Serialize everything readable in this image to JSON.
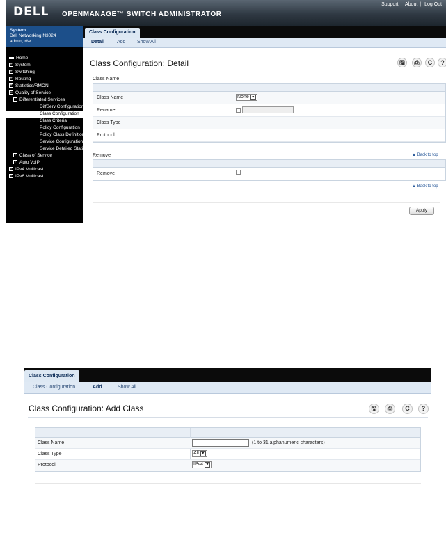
{
  "header": {
    "logo": "DELL",
    "product_title": "OPENMANAGE™ SWITCH ADMINISTRATOR",
    "links": [
      "Support",
      "About",
      "Log Out"
    ]
  },
  "system": {
    "title": "System",
    "device": "Dell Networking N3024",
    "user": "admin, r/w"
  },
  "nav_tree": [
    {
      "label": "Home",
      "level": 0,
      "icon": "home-icon"
    },
    {
      "label": "System",
      "level": 0,
      "icon": "expand-icon"
    },
    {
      "label": "Switching",
      "level": 0,
      "icon": "expand-icon"
    },
    {
      "label": "Routing",
      "level": 0,
      "icon": "expand-icon"
    },
    {
      "label": "Statistics/RMON",
      "level": 0,
      "icon": "expand-icon"
    },
    {
      "label": "Quality of Service",
      "level": 0,
      "icon": "collapse-icon"
    },
    {
      "label": "Differentiated Services",
      "level": 1,
      "icon": "collapse-icon"
    },
    {
      "label": "DiffServ Configuration",
      "level": 2
    },
    {
      "label": "Class Configuration",
      "level": 2,
      "selected": true
    },
    {
      "label": "Class Criteria",
      "level": 2
    },
    {
      "label": "Policy Configuration",
      "level": 2
    },
    {
      "label": "Policy Class Definition",
      "level": 2
    },
    {
      "label": "Service Configuration",
      "level": 2
    },
    {
      "label": "Service Detailed Statistics",
      "level": 2
    },
    {
      "label": "Class of Service",
      "level": 1,
      "icon": "expand-icon"
    },
    {
      "label": "Auto VoIP",
      "level": 1,
      "icon": "expand-icon"
    },
    {
      "label": "IPv4 Multicast",
      "level": 0,
      "icon": "expand-icon"
    },
    {
      "label": "IPv6 Multicast",
      "level": 0,
      "icon": "expand-icon"
    }
  ],
  "detail_page": {
    "tab": "Class Configuration",
    "subnav": [
      "Detail",
      "Add",
      "Show All"
    ],
    "active_subnav": "Detail",
    "title": "Class Configuration: Detail",
    "tool_icons": [
      "save-icon",
      "print-icon",
      "refresh-icon",
      "help-icon"
    ],
    "section1_title": "Class Name",
    "fields": {
      "class_name": {
        "label": "Class Name",
        "value": "None"
      },
      "rename": {
        "label": "Rename",
        "value": ""
      },
      "class_type": {
        "label": "Class Type",
        "value": ""
      },
      "protocol": {
        "label": "Protocol",
        "value": ""
      }
    },
    "section2_title": "Remove",
    "remove_label": "Remove",
    "back_to_top": "Back to top",
    "apply": "Apply"
  },
  "add_page": {
    "tab": "Class Configuration",
    "subnav": [
      "Class Configuration",
      "Add",
      "Show All"
    ],
    "active_subnav": "Add",
    "title": "Class Configuration: Add Class",
    "fields": {
      "class_name": {
        "label": "Class Name",
        "value": "",
        "hint": "(1 to 31 alphanumeric characters)"
      },
      "class_type": {
        "label": "Class Type",
        "value": "All"
      },
      "protocol": {
        "label": "Protocol",
        "value": "IPv4"
      }
    }
  }
}
